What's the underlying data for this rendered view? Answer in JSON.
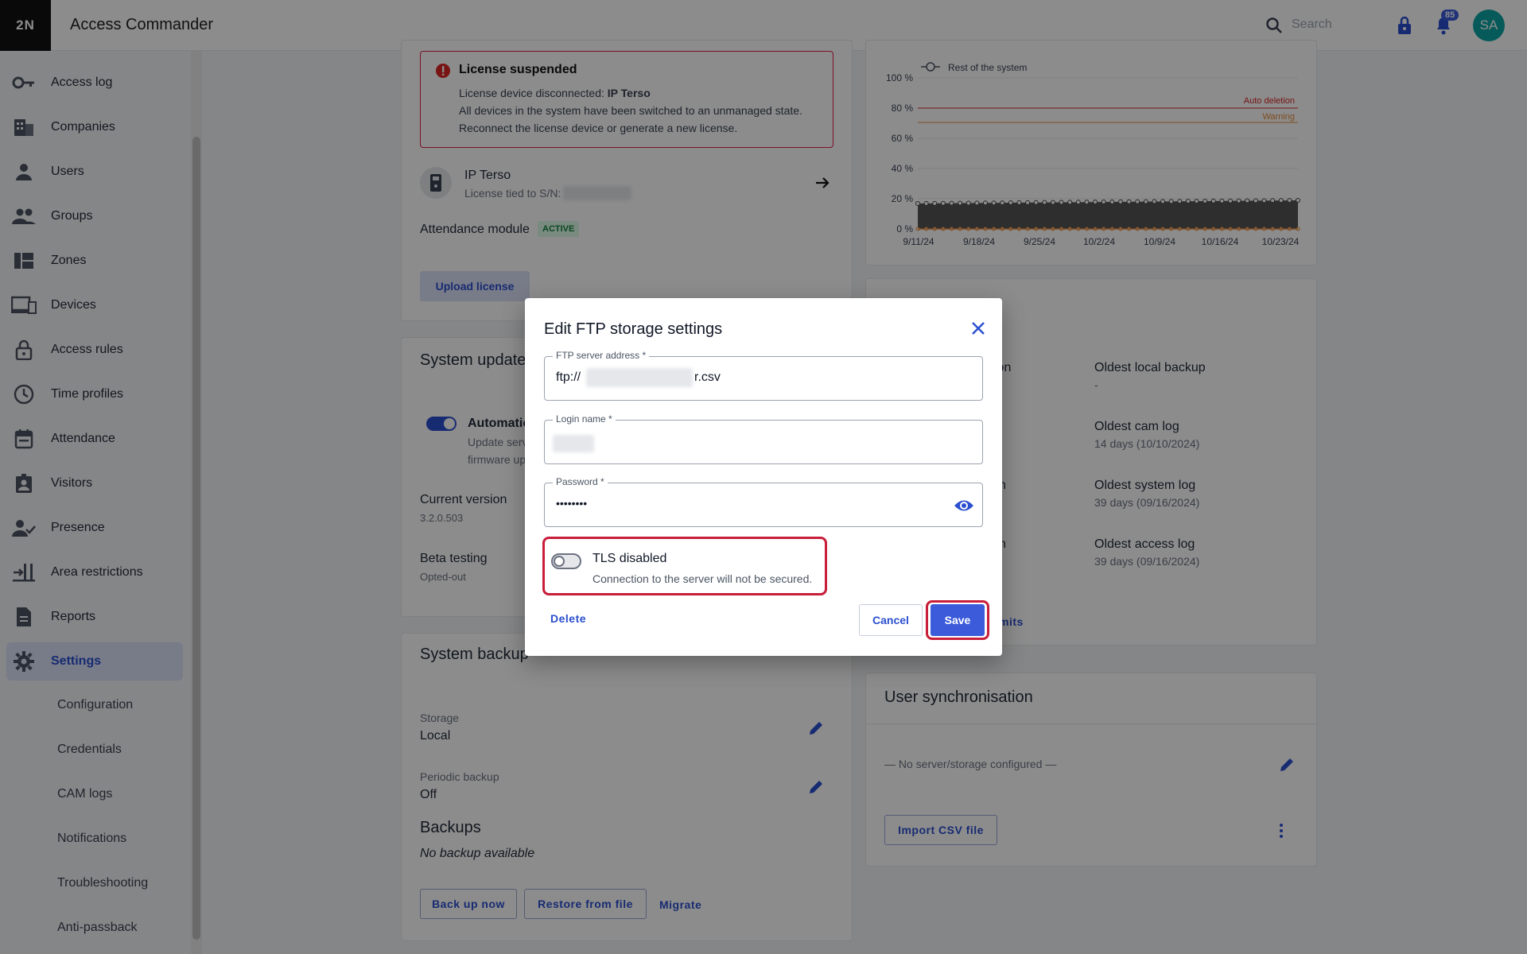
{
  "header": {
    "logo": "2N",
    "title": "Access Commander",
    "search_placeholder": "Search",
    "notification_count": "85",
    "avatar_initials": "SA"
  },
  "sidebar": {
    "items": [
      {
        "label": "Access log",
        "icon": "key-icon"
      },
      {
        "label": "Companies",
        "icon": "building-icon"
      },
      {
        "label": "Users",
        "icon": "person-icon"
      },
      {
        "label": "Groups",
        "icon": "people-icon"
      },
      {
        "label": "Zones",
        "icon": "zones-icon"
      },
      {
        "label": "Devices",
        "icon": "devices-icon"
      },
      {
        "label": "Access rules",
        "icon": "lock-icon"
      },
      {
        "label": "Time profiles",
        "icon": "clock-icon"
      },
      {
        "label": "Attendance",
        "icon": "calendar-icon"
      },
      {
        "label": "Visitors",
        "icon": "visitor-badge-icon"
      },
      {
        "label": "Presence",
        "icon": "person-check-icon"
      },
      {
        "label": "Area restrictions",
        "icon": "area-icon"
      },
      {
        "label": "Reports",
        "icon": "report-icon"
      },
      {
        "label": "Settings",
        "icon": "gear-icon"
      }
    ],
    "subitems": [
      "Configuration",
      "Credentials",
      "CAM logs",
      "Notifications",
      "Troubleshooting",
      "Anti-passback"
    ]
  },
  "license": {
    "alert_title": "License suspended",
    "disconnected_prefix": "License device disconnected:",
    "disconnected_device": "IP Terso",
    "line2": "All devices in the system have been switched to an unmanaged state.",
    "line3": "Reconnect the license device or generate a new license.",
    "device_name": "IP Terso",
    "device_sub": "License tied to S/N:",
    "attendance_label": "Attendance module",
    "attendance_status": "ACTIVE",
    "upload_button": "Upload license"
  },
  "system_update": {
    "title": "System update",
    "auto_label": "Automatic",
    "auto_sub1": "Update serv",
    "auto_sub2": "firmware up",
    "current_version_label": "Current version",
    "current_version": "3.2.0.503",
    "beta_label": "Beta testing",
    "beta_value": "Opted-out"
  },
  "system_backup": {
    "title": "System backup",
    "storage_label": "Storage",
    "storage_value": "Local",
    "periodic_label": "Periodic backup",
    "periodic_value": "Off",
    "backups_title": "Backups",
    "no_backup": "No backup available",
    "backup_now": "Back up now",
    "restore": "Restore from file",
    "migrate": "Migrate"
  },
  "chart": {
    "legend_last": "Rest of the system",
    "y_ticks": [
      "100 %",
      "80 %",
      "60 %",
      "40 %",
      "20 %",
      "0 %"
    ],
    "x_ticks": [
      "9/11/24",
      "9/18/24",
      "9/25/24",
      "10/2/24",
      "10/9/24",
      "10/16/24",
      "10/23/24"
    ],
    "auto_deletion": "Auto deletion",
    "warning": "Warning",
    "auto_deletion_color": "#dc2626",
    "warning_color": "#ea8a3a"
  },
  "log_retention": {
    "col1_partial": [
      "ion",
      "n",
      "n"
    ],
    "oldest_local_backup": "Oldest local backup",
    "oldest_local_backup_value": "-",
    "oldest_cam_log": "Oldest cam log",
    "oldest_cam_log_value": "14 days (10/10/2024)",
    "oldest_system_log": "Oldest system log",
    "oldest_system_log_value": "39 days (09/16/2024)",
    "oldest_access_log": "Oldest access log",
    "oldest_access_log_value": "39 days (09/16/2024)",
    "limits_link": "mits"
  },
  "user_sync": {
    "title": "User synchronisation",
    "empty": "— No server/storage configured —",
    "import_button": "Import CSV file"
  },
  "dialog": {
    "title": "Edit FTP storage settings",
    "ftp_label": "FTP server address *",
    "ftp_prefix": "ftp://",
    "ftp_suffix": "r.csv",
    "login_label": "Login name *",
    "password_label": "Password *",
    "password_value": "••••••••",
    "tls_title": "TLS disabled",
    "tls_sub": "Connection to the server will not be secured.",
    "delete": "Delete",
    "cancel": "Cancel",
    "save": "Save"
  }
}
